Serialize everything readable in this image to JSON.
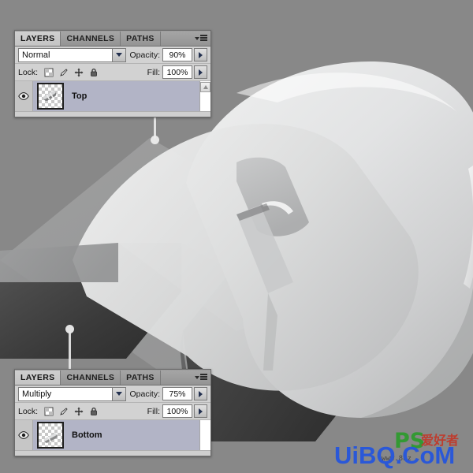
{
  "canvas": {
    "background_color": "#888888",
    "artwork_name": "isometric-3d-computer-mouse"
  },
  "panels": [
    {
      "id": "top-layers-panel",
      "tabs": [
        {
          "label": "LAYERS",
          "active": true
        },
        {
          "label": "CHANNELS",
          "active": false
        },
        {
          "label": "PATHS",
          "active": false
        }
      ],
      "menu_icon": "panel-menu-icon",
      "blend_mode": "Normal",
      "opacity_label": "Opacity:",
      "opacity_value": "90%",
      "lock_label": "Lock:",
      "lock_icons": [
        "lock-transparent-pixels-icon",
        "lock-image-pixels-icon",
        "lock-position-icon",
        "lock-all-icon"
      ],
      "fill_label": "Fill:",
      "fill_value": "100%",
      "layer": {
        "name": "Top",
        "visible": true,
        "visibility_icon": "eye-icon",
        "thumbnail": "layer-thumbnail-mouse-top"
      }
    },
    {
      "id": "bottom-layers-panel",
      "tabs": [
        {
          "label": "LAYERS",
          "active": true
        },
        {
          "label": "CHANNELS",
          "active": false
        },
        {
          "label": "PATHS",
          "active": false
        }
      ],
      "menu_icon": "panel-menu-icon",
      "blend_mode": "Multiply",
      "opacity_label": "Opacity:",
      "opacity_value": "75%",
      "lock_label": "Lock:",
      "lock_icons": [
        "lock-transparent-pixels-icon",
        "lock-image-pixels-icon",
        "lock-position-icon",
        "lock-all-icon"
      ],
      "fill_label": "Fill:",
      "fill_value": "100%",
      "layer": {
        "name": "Bottom",
        "visible": true,
        "visibility_icon": "eye-icon",
        "thumbnail": "layer-thumbnail-mouse-bottom"
      }
    }
  ],
  "callouts": [
    {
      "name": "callout-top-layer",
      "from": "top-layers-panel",
      "to": "mouse-top-surface"
    },
    {
      "name": "callout-bottom-layer",
      "from": "bottom-layers-panel",
      "to": "mouse-bottom-shadow"
    }
  ],
  "watermark": {
    "main_text": "UiBQ.CoM",
    "main_color": "#2a58d8",
    "overlay_text": "PS",
    "overlay_color": "#2f9a2f",
    "sub_text": "www.88z",
    "cn_text": "爱好者"
  }
}
